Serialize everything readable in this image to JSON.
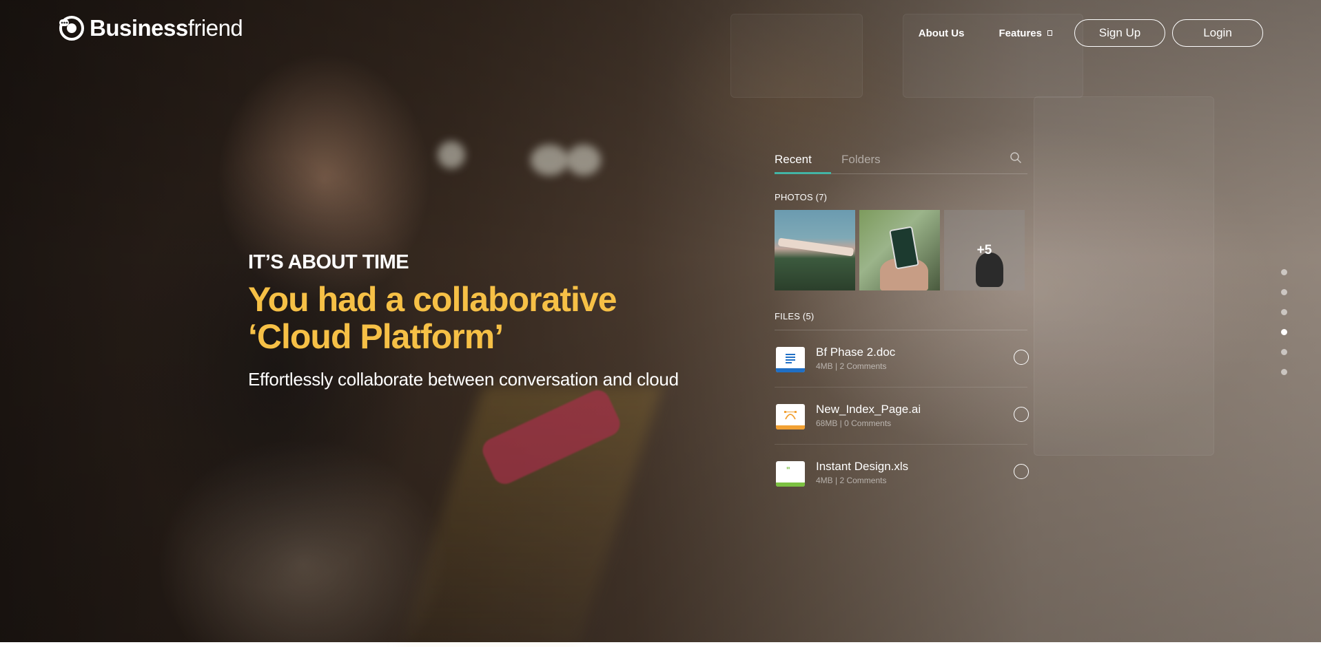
{
  "brand": {
    "name_bold": "Business",
    "name_light": "friend",
    "logo_icon": "chat-bubble-logo-icon"
  },
  "nav": {
    "about_label": "About Us",
    "features_label": "Features",
    "signup_label": "Sign Up",
    "login_label": "Login",
    "features_icon": "dropdown-caret-icon"
  },
  "hero": {
    "eyebrow": "IT’S ABOUT TIME",
    "headline_line1": "You had a collaborative",
    "headline_line2": "‘Cloud Platform’",
    "subheadline": "Effortlessly collaborate between conversation and cloud",
    "accent_color": "#f6c046"
  },
  "panel": {
    "tabs": [
      {
        "label": "Recent",
        "active": true
      },
      {
        "label": "Folders",
        "active": false
      }
    ],
    "tab_accent_color": "#43b5a6",
    "search_icon": "search-icon",
    "photos_title": "PHOTOS (7)",
    "photos_more": "+5",
    "files_title": "FILES (5)",
    "files": [
      {
        "name": "Bf Phase 2.doc",
        "meta": "4MB | 2 Comments",
        "icon": "doc-file-icon",
        "color": "#1f6fc5"
      },
      {
        "name": "New_Index_Page.ai",
        "meta": "68MB | 0 Comments",
        "icon": "ai-file-icon",
        "color": "#f2a133"
      },
      {
        "name": "Instant Design.xls",
        "meta": "4MB | 2 Comments",
        "icon": "xls-file-icon",
        "color": "#7cc142"
      }
    ]
  },
  "pagination": {
    "count": 6,
    "active_index": 3
  }
}
